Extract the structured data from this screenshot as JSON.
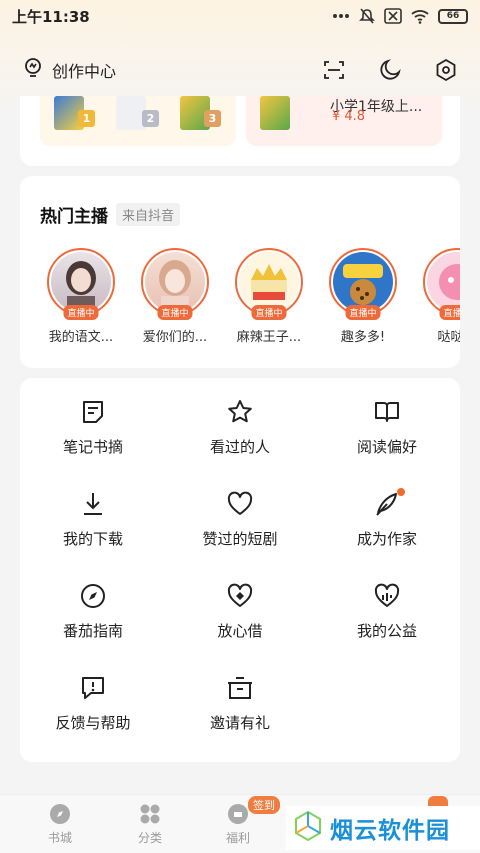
{
  "status_bar": {
    "time": "上午11:38",
    "battery": "66"
  },
  "header": {
    "creator_label": "创作中心",
    "icons": [
      "scan-icon",
      "moon-icon",
      "settings-icon"
    ]
  },
  "books": {
    "ranks": [
      "1",
      "2",
      "3"
    ],
    "title_fragment": "小学1年级上...",
    "score": "¥ 4.8"
  },
  "anchors": {
    "title": "热门主播",
    "source": "来自抖音",
    "live_label": "直播中",
    "items": [
      {
        "name": "我的语文..."
      },
      {
        "name": "爱你们的..."
      },
      {
        "name": "麻辣王子..."
      },
      {
        "name": "趣多多!"
      },
      {
        "name": "哒哒猫"
      }
    ]
  },
  "menu": {
    "items": [
      {
        "label": "笔记书摘",
        "icon": "note-icon"
      },
      {
        "label": "看过的人",
        "icon": "star-icon"
      },
      {
        "label": "阅读偏好",
        "icon": "book-icon"
      },
      {
        "label": "我的下载",
        "icon": "download-icon"
      },
      {
        "label": "赞过的短剧",
        "icon": "heart-icon"
      },
      {
        "label": "成为作家",
        "icon": "pen-icon"
      },
      {
        "label": "番茄指南",
        "icon": "compass-icon"
      },
      {
        "label": "放心借",
        "icon": "shield-heart-icon"
      },
      {
        "label": "我的公益",
        "icon": "charity-icon"
      },
      {
        "label": "反馈与帮助",
        "icon": "feedback-icon"
      },
      {
        "label": "邀请有礼",
        "icon": "gift-icon"
      }
    ]
  },
  "bottom_nav": {
    "items": [
      {
        "label": "书城",
        "icon": "compass-nav-icon"
      },
      {
        "label": "分类",
        "icon": "grid-nav-icon"
      },
      {
        "label": "福利",
        "icon": "coin-nav-icon"
      }
    ],
    "sign_badge": "签到"
  },
  "watermark": {
    "text": "烟云软件园"
  },
  "colors": {
    "accent": "#ef6a3a",
    "live": "#ef6a3a",
    "watermark": "#1a90d8"
  }
}
